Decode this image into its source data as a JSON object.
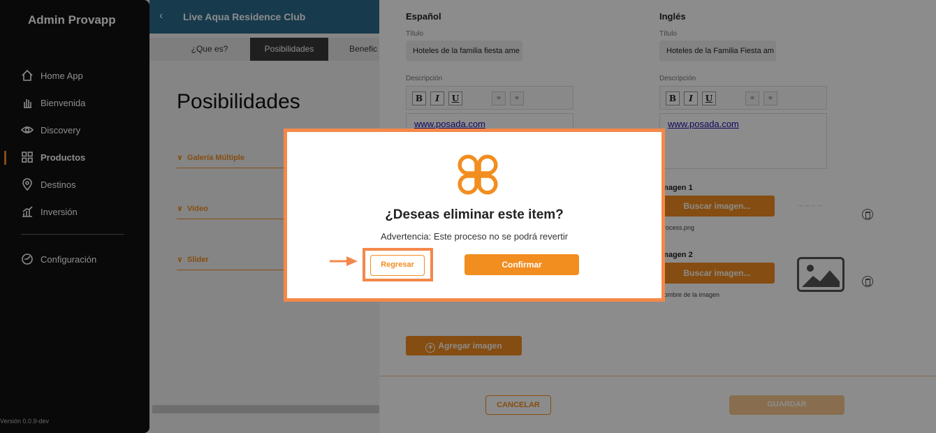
{
  "sidebar": {
    "brand": "Admin Provapp",
    "items": [
      {
        "label": "Home App",
        "icon": "home-icon"
      },
      {
        "label": "Bienvenida",
        "icon": "hand-icon"
      },
      {
        "label": "Discovery",
        "icon": "eye-icon"
      },
      {
        "label": "Productos",
        "icon": "grid-icon",
        "active": true
      },
      {
        "label": "Destinos",
        "icon": "location-pin-icon"
      },
      {
        "label": "Inversión",
        "icon": "chart-icon"
      }
    ],
    "config_label": "Configuración",
    "version": "Versión 0.0.9-dev"
  },
  "header": {
    "title": "Live Aqua Residence Club"
  },
  "tabs": [
    "¿Que es?",
    "Posibilidades",
    "Benefic"
  ],
  "page": {
    "title": "Posibilidades",
    "sections": [
      "Galería Múltiple",
      "Video",
      "Slider"
    ]
  },
  "editor": {
    "spanish": {
      "heading": "Español",
      "title_label": "Título",
      "title_value": "Hoteles de la familia fiesta ame",
      "description_label": "Descripción",
      "link_text": "www.posada.com"
    },
    "english": {
      "heading": "Inglés",
      "title_label": "Título",
      "title_value": "Hoteles de la Familia Fiesta am",
      "description_label": "Descripción",
      "link_text": "www.posada.com"
    },
    "toolbar": {
      "bold": "B",
      "italic": "I",
      "underline": "U"
    },
    "images": [
      {
        "label": "Imagen 1",
        "button": "Buscar imagen...",
        "filename": "Process.png"
      },
      {
        "label": "Imagen 2",
        "button": "Buscar imagen...",
        "filename": "Nombre de la imagen"
      }
    ],
    "add_image": "Agregar imagen",
    "cancel": "CANCELAR",
    "save": "GUARDAR"
  },
  "modal": {
    "title": "¿Deseas eliminar este item?",
    "warning": "Advertencia: Este proceso no se podrá revertir",
    "back_button": "Regresar",
    "confirm_button": "Confirmar",
    "accent": "#f28d1f",
    "highlight": "#f4884a"
  }
}
